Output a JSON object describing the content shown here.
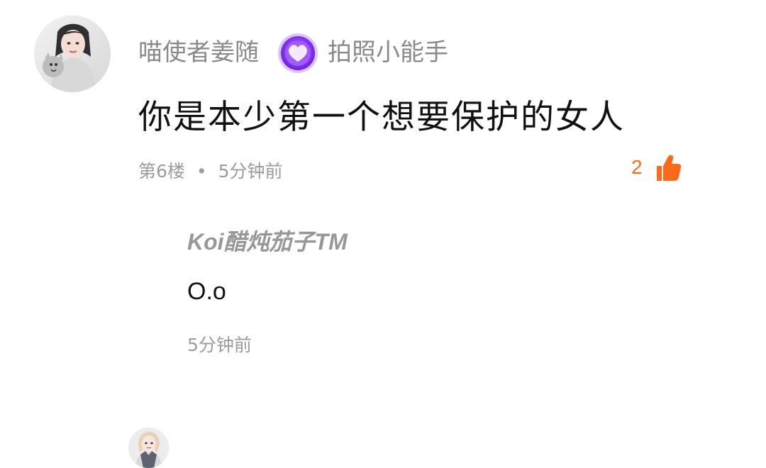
{
  "comment": {
    "username": "喵使者姜随",
    "badge_label": "拍照小能手",
    "content": "你是本少第一个想要保护的女人",
    "floor": "第6楼",
    "separator": "•",
    "time": "5分钟前",
    "likes": "2",
    "like_color": "#ff6a1a",
    "badge_colors": [
      "#7b2ff7",
      "#b77cff",
      "#f6d7ff"
    ]
  },
  "reply": {
    "username": "Koi醋炖茄子TM",
    "content": "O.o",
    "time": "5分钟前"
  }
}
